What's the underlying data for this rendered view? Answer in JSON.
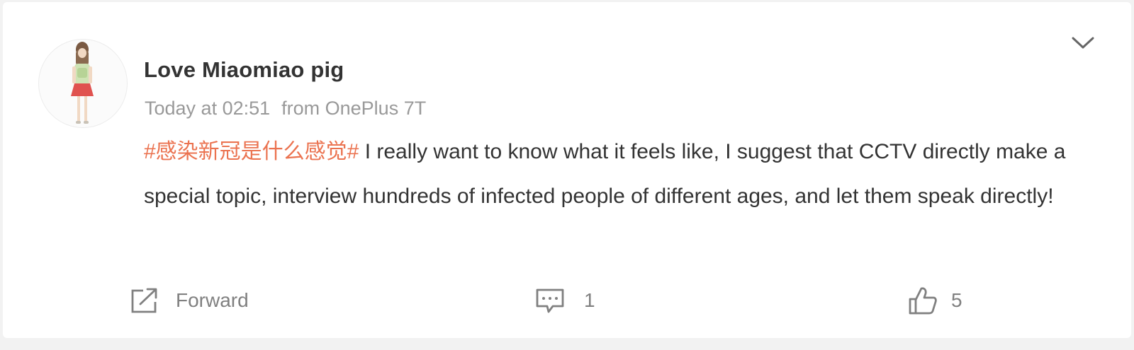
{
  "post": {
    "author": "Love Miaomiao pig",
    "time": "Today at 02:51",
    "source": "from OnePlus 7T",
    "hashtag": "#感染新冠是什么感觉#",
    "text": " I really want to know what it feels like, I suggest that CCTV directly make a special topic, interview hundreds of infected people of different ages, and let them speak directly!",
    "more_icon": "chevron-down-icon"
  },
  "actions": {
    "forward": {
      "label": "Forward",
      "icon": "share-arrow-icon"
    },
    "comment": {
      "count": "1",
      "icon": "comment-icon"
    },
    "like": {
      "count": "5",
      "icon": "thumbs-up-icon"
    }
  },
  "colors": {
    "hashtag": "#eb7350",
    "author": "#333333",
    "meta": "#999999",
    "action": "#808080",
    "background": "#f2f2f2",
    "card": "#ffffff"
  }
}
